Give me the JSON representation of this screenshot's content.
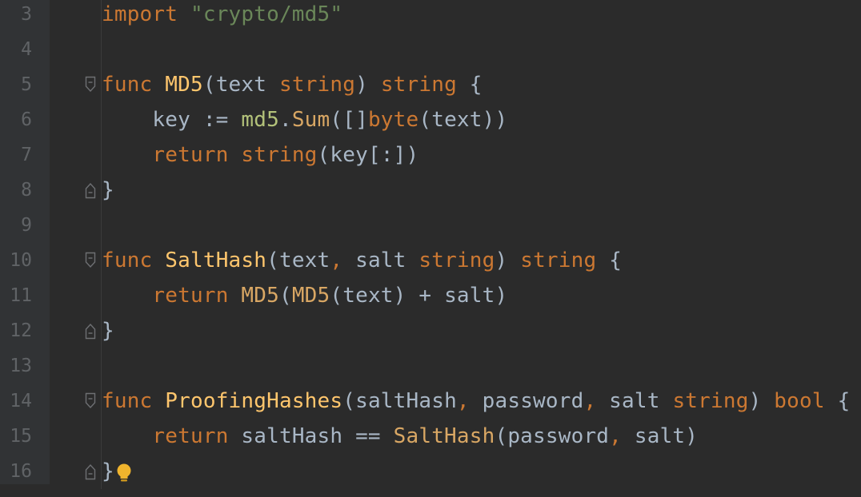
{
  "colors": {
    "background": "#2b2b2b",
    "gutter": "#313335",
    "line_number": "#606366",
    "keyword": "#cc7832",
    "function_name": "#ffc66d",
    "string": "#6a8759",
    "identifier": "#a9b7c6",
    "intention_bulb": "#f0b42d"
  },
  "lines": [
    {
      "number": "3",
      "fold": "none",
      "tokens": [
        [
          "keyword",
          "import"
        ],
        [
          "plain",
          " "
        ],
        [
          "string",
          "\"crypto/md5\""
        ]
      ]
    },
    {
      "number": "4",
      "fold": "none",
      "tokens": []
    },
    {
      "number": "5",
      "fold": "start",
      "tokens": [
        [
          "keyword",
          "func"
        ],
        [
          "plain",
          " "
        ],
        [
          "func",
          "MD5"
        ],
        [
          "punct",
          "("
        ],
        [
          "plain",
          "text "
        ],
        [
          "keyword",
          "string"
        ],
        [
          "punct",
          ")"
        ],
        [
          "plain",
          " "
        ],
        [
          "keyword",
          "string"
        ],
        [
          "plain",
          " {"
        ]
      ]
    },
    {
      "number": "6",
      "fold": "none",
      "tokens": [
        [
          "plain",
          "    key := "
        ],
        [
          "pkg",
          "md5"
        ],
        [
          "punct",
          "."
        ],
        [
          "call",
          "Sum"
        ],
        [
          "punct",
          "([]"
        ],
        [
          "keyword",
          "byte"
        ],
        [
          "punct",
          "(text))"
        ]
      ]
    },
    {
      "number": "7",
      "fold": "none",
      "tokens": [
        [
          "plain",
          "    "
        ],
        [
          "keyword",
          "return"
        ],
        [
          "plain",
          " "
        ],
        [
          "keyword",
          "string"
        ],
        [
          "punct",
          "(key[:])"
        ]
      ]
    },
    {
      "number": "8",
      "fold": "end",
      "tokens": [
        [
          "plain",
          "}"
        ]
      ]
    },
    {
      "number": "9",
      "fold": "none",
      "tokens": []
    },
    {
      "number": "10",
      "fold": "start",
      "tokens": [
        [
          "keyword",
          "func"
        ],
        [
          "plain",
          " "
        ],
        [
          "func",
          "SaltHash"
        ],
        [
          "punct",
          "("
        ],
        [
          "plain",
          "text"
        ],
        [
          "keyword",
          ","
        ],
        [
          "plain",
          " salt "
        ],
        [
          "keyword",
          "string"
        ],
        [
          "punct",
          ")"
        ],
        [
          "plain",
          " "
        ],
        [
          "keyword",
          "string"
        ],
        [
          "plain",
          " {"
        ]
      ]
    },
    {
      "number": "11",
      "fold": "none",
      "tokens": [
        [
          "plain",
          "    "
        ],
        [
          "keyword",
          "return"
        ],
        [
          "plain",
          " "
        ],
        [
          "call",
          "MD5"
        ],
        [
          "punct",
          "("
        ],
        [
          "call",
          "MD5"
        ],
        [
          "punct",
          "(text) + salt)"
        ]
      ]
    },
    {
      "number": "12",
      "fold": "end",
      "tokens": [
        [
          "plain",
          "}"
        ]
      ]
    },
    {
      "number": "13",
      "fold": "none",
      "tokens": []
    },
    {
      "number": "14",
      "fold": "start",
      "tokens": [
        [
          "keyword",
          "func"
        ],
        [
          "plain",
          " "
        ],
        [
          "func",
          "ProofingHashes"
        ],
        [
          "punct",
          "("
        ],
        [
          "plain",
          "saltHash"
        ],
        [
          "keyword",
          ","
        ],
        [
          "plain",
          " password"
        ],
        [
          "keyword",
          ","
        ],
        [
          "plain",
          " salt "
        ],
        [
          "keyword",
          "string"
        ],
        [
          "punct",
          ")"
        ],
        [
          "plain",
          " "
        ],
        [
          "keyword",
          "bool"
        ],
        [
          "plain",
          " {"
        ]
      ]
    },
    {
      "number": "15",
      "fold": "none",
      "tokens": [
        [
          "plain",
          "    "
        ],
        [
          "keyword",
          "return"
        ],
        [
          "plain",
          " saltHash == "
        ],
        [
          "call",
          "SaltHash"
        ],
        [
          "punct",
          "(password"
        ],
        [
          "keyword",
          ","
        ],
        [
          "plain",
          " salt)"
        ]
      ]
    },
    {
      "number": "16",
      "fold": "end",
      "tokens": [
        [
          "plain",
          "}"
        ]
      ],
      "bulb": true
    }
  ],
  "icons": {
    "fold_start": "fold-collapse-icon",
    "fold_end": "fold-end-icon",
    "bulb": "intention-bulb-icon"
  }
}
